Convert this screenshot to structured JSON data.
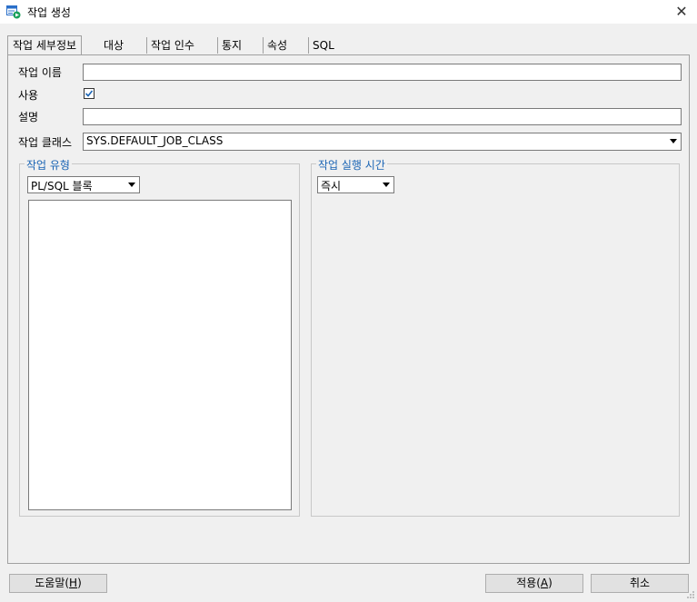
{
  "window": {
    "title": "작업 생성",
    "close_glyph": "✕"
  },
  "tabs": [
    {
      "label": "작업 세부정보",
      "active": true
    },
    {
      "label": "대상"
    },
    {
      "label": "작업 인수"
    },
    {
      "label": "통지"
    },
    {
      "label": "속성"
    },
    {
      "label": "SQL"
    }
  ],
  "form": {
    "job_name_label": "작업 이름",
    "job_name_value": "",
    "enabled_label": "사용",
    "enabled_checked": true,
    "description_label": "설명",
    "description_value": "",
    "job_class_label": "작업 클래스",
    "job_class_value": "SYS.DEFAULT_JOB_CLASS"
  },
  "job_type_group": {
    "title": "작업 유형",
    "select_value": "PL/SQL 블록",
    "code_text": ""
  },
  "schedule_group": {
    "title": "작업 실행 시간",
    "select_value": "즉시"
  },
  "buttons": {
    "help": {
      "text": "도움말(",
      "mnemonic": "H",
      "suffix": ")"
    },
    "apply": {
      "text": "적용(",
      "mnemonic": "A",
      "suffix": ")"
    },
    "cancel": {
      "label": "취소"
    }
  },
  "colors": {
    "group_title": "#1a64b4",
    "icon_green": "#18a05a",
    "icon_blue": "#2a6fc9"
  }
}
